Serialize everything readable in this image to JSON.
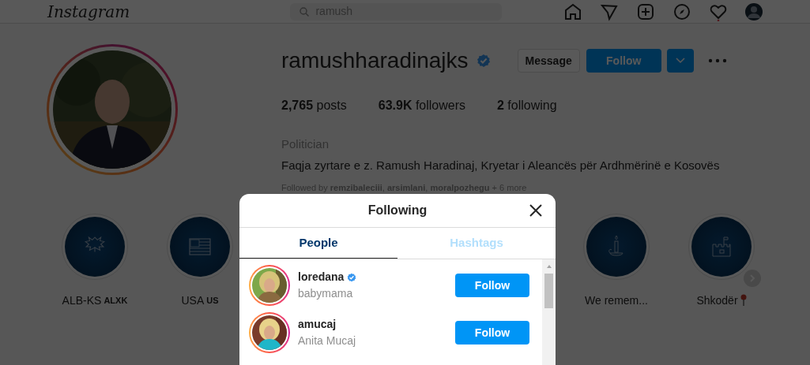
{
  "nav": {
    "logo": "Instagram",
    "search": {
      "value": "ramush"
    }
  },
  "profile": {
    "username": "ramushharadinajks",
    "verified": true,
    "buttons": {
      "message": "Message",
      "follow": "Follow"
    },
    "stats": [
      {
        "count": "2,765",
        "label": "posts"
      },
      {
        "count": "63.9K",
        "label": "followers"
      },
      {
        "count": "2",
        "label": "following"
      }
    ],
    "category": "Politician",
    "bio": "Faqja zyrtare e z. Ramush Haradinaj, Kryetar i Aleancës për Ardhmërinë e Kosovës",
    "followed_by": "Followed by **remzibaleciii**, **arsimlani**, **moralpozhegu** + 6 more"
  },
  "highlights": [
    {
      "kind": "eagle",
      "label": "ALB-KS",
      "tag": "ALXK"
    },
    {
      "kind": "flag",
      "label": "USA",
      "tag": "US"
    },
    {
      "kind": "candle",
      "label": "We remem..."
    },
    {
      "kind": "castle",
      "label": "Shkodër",
      "pin": true
    }
  ],
  "modal": {
    "title": "Following",
    "tabs": [
      {
        "label": "People",
        "selected": true
      },
      {
        "label": "Hashtags",
        "selected": false
      }
    ],
    "users": [
      {
        "username": "loredana",
        "verified": true,
        "name": "babymama",
        "button": "Follow"
      },
      {
        "username": "amucaj",
        "verified": false,
        "name": "Anita Mucaj",
        "button": "Follow"
      }
    ]
  }
}
